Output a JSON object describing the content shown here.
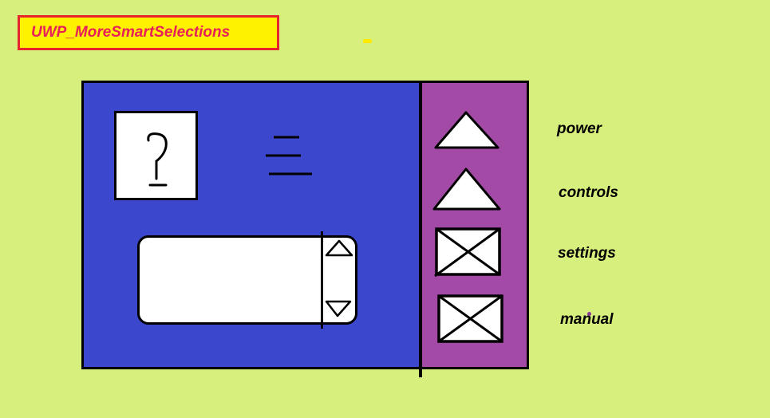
{
  "app": {
    "title": "UWP_MoreSmartSelections"
  },
  "help": {
    "glyph": "?"
  },
  "side_buttons": [
    {
      "name": "power",
      "label": "power",
      "icon": "triangle-up-icon"
    },
    {
      "name": "controls",
      "label": "controls",
      "icon": "triangle-up-icon"
    },
    {
      "name": "settings",
      "label": "settings",
      "icon": "x-box-icon"
    },
    {
      "name": "manual",
      "label": "manual",
      "icon": "x-box-icon"
    }
  ],
  "colors": {
    "background": "#d7ef7c",
    "title_bg": "#fff200",
    "title_border": "#e8242c",
    "title_text": "#e8205a",
    "panel": "#3b47cc",
    "side_panel": "#a24aa6"
  }
}
